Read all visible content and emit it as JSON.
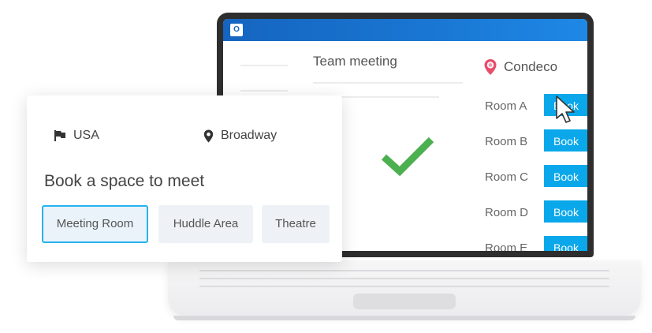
{
  "app": {
    "name": "Condeco",
    "outlook_logo": "O",
    "brand_color": "#e84d6b",
    "accent_color": "#0aa8ea",
    "check_color": "#4caf50"
  },
  "outlook": {
    "meeting_title": "Team meeting"
  },
  "condeco_panel": {
    "header": "Condeco",
    "icon": "location-pin-icon",
    "rooms": [
      {
        "label": "Room A",
        "action": "Book"
      },
      {
        "label": "Room B",
        "action": "Book"
      },
      {
        "label": "Room C",
        "action": "Book"
      },
      {
        "label": "Room D",
        "action": "Book"
      },
      {
        "label": "Room E",
        "action": "Book"
      }
    ]
  },
  "booking_card": {
    "country": {
      "icon": "flag-icon",
      "label": "USA"
    },
    "building": {
      "icon": "map-pin-icon",
      "label": "Broadway"
    },
    "heading": "Book a space to meet",
    "space_types": [
      {
        "label": "Meeting Room",
        "selected": true
      },
      {
        "label": "Huddle Area",
        "selected": false
      },
      {
        "label": "Theatre",
        "selected": false
      }
    ]
  }
}
